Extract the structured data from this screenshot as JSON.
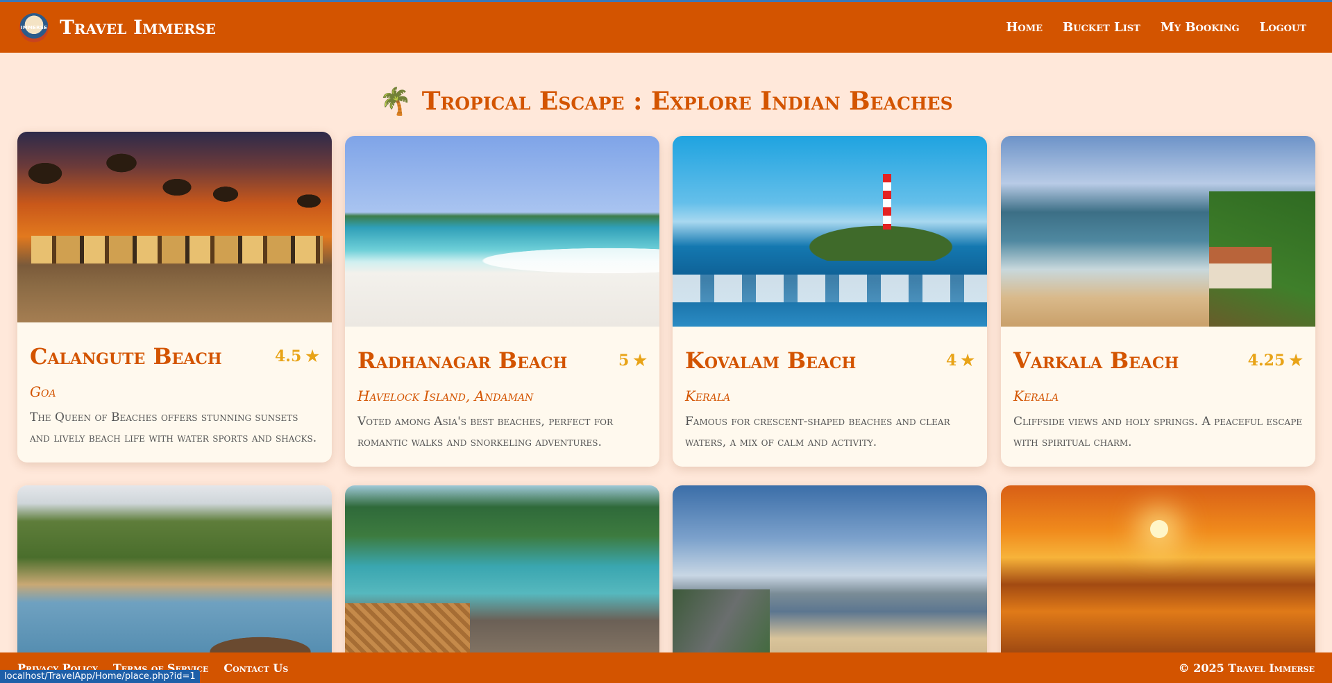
{
  "app": {
    "brand": "Travel Immerse",
    "logo_text": "IMMERSE"
  },
  "nav": {
    "items": [
      {
        "label": "Home"
      },
      {
        "label": "Bucket List"
      },
      {
        "label": "My Booking"
      },
      {
        "label": "Logout"
      }
    ]
  },
  "page": {
    "title_icon": "🌴",
    "title": "Tropical Escape : Explore Indian Beaches"
  },
  "cards": [
    {
      "name": "Calangute Beach",
      "rating": "4.5",
      "location": "Goa",
      "description": "The Queen of Beaches offers stunning sunsets and lively beach life with water sports and shacks."
    },
    {
      "name": "Radhanagar Beach",
      "rating": "5",
      "location": "Havelock Island, Andaman",
      "description": "Voted among Asia's best beaches, perfect for romantic walks and snorkeling adventures."
    },
    {
      "name": "Kovalam Beach",
      "rating": "4",
      "location": "Kerala",
      "description": "Famous for crescent-shaped beaches and clear waters, a mix of calm and activity."
    },
    {
      "name": "Varkala Beach",
      "rating": "4.25",
      "location": "Kerala",
      "description": "Cliffside views and holy springs. A peaceful escape with spiritual charm."
    }
  ],
  "rating_star": "★",
  "footer": {
    "links": [
      {
        "label": "Privacy Policy"
      },
      {
        "label": "Terms of Service"
      },
      {
        "label": "Contact Us"
      }
    ],
    "copyright": "© 2025 Travel Immerse"
  },
  "status_bar": {
    "url": "localhost/TravelApp/Home/place.php?id=1"
  },
  "colors": {
    "accent": "#d35400",
    "background": "#ffe8da",
    "card": "#fff9ee",
    "rating": "#e8a317"
  }
}
